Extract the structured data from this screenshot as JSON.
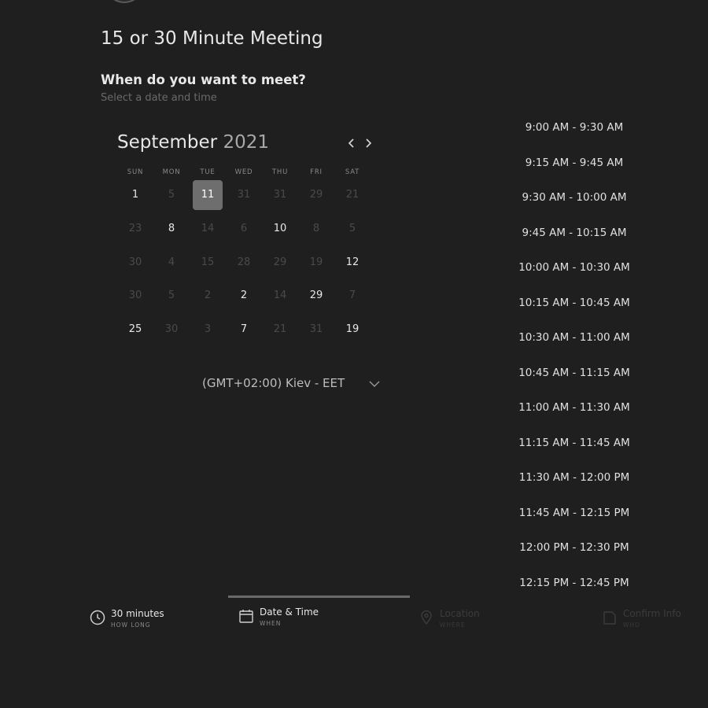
{
  "event": {
    "title": "15 or 30 Minute Meeting"
  },
  "prompt": {
    "question": "When do you want to meet?",
    "hint": "Select a date and time"
  },
  "calendar": {
    "month": "September",
    "year": "2021",
    "weekdays": [
      "SUN",
      "MON",
      "TUE",
      "WED",
      "THU",
      "FRI",
      "SAT"
    ],
    "weeks": [
      [
        "1",
        "5",
        "11",
        "31",
        "31",
        "29",
        "21"
      ],
      [
        "23",
        "8",
        "14",
        "6",
        "10",
        "8",
        "5"
      ],
      [
        "30",
        "4",
        "15",
        "28",
        "29",
        "19",
        "12"
      ],
      [
        "30",
        "5",
        "2",
        "2",
        "14",
        "29",
        "7"
      ],
      [
        "25",
        "30",
        "3",
        "7",
        "21",
        "31",
        "19"
      ]
    ],
    "available": [
      [
        true,
        false,
        true,
        false,
        false,
        false,
        false
      ],
      [
        false,
        true,
        false,
        false,
        true,
        false,
        false
      ],
      [
        false,
        false,
        false,
        false,
        false,
        false,
        true
      ],
      [
        false,
        false,
        false,
        true,
        false,
        true,
        false
      ],
      [
        true,
        false,
        false,
        true,
        false,
        false,
        true
      ]
    ],
    "selected": [
      0,
      2
    ]
  },
  "timezone": {
    "label": "(GMT+02:00) Kiev - EET"
  },
  "time_slots": [
    "9:00 AM - 9:30 AM",
    "9:15 AM - 9:45 AM",
    "9:30 AM - 10:00 AM",
    "9:45 AM - 10:15 AM",
    "10:00 AM - 10:30 AM",
    "10:15 AM - 10:45 AM",
    "10:30 AM - 11:00 AM",
    "10:45 AM - 11:15 AM",
    "11:00 AM - 11:30 AM",
    "11:15 AM - 11:45 AM",
    "11:30 AM - 12:00 PM",
    "11:45 AM - 12:15 PM",
    "12:00 PM - 12:30 PM",
    "12:15 PM - 12:45 PM"
  ],
  "steps": [
    {
      "label": "30 minutes",
      "sub": "HOW LONG",
      "icon": "clock-icon"
    },
    {
      "label": "Date & Time",
      "sub": "WHEN",
      "icon": "calendar-icon"
    },
    {
      "label": "Location",
      "sub": "WHERE",
      "icon": "location-pin-icon"
    },
    {
      "label": "Confirm Info",
      "sub": "WHO",
      "icon": "document-icon"
    }
  ],
  "colors": {
    "background": "#1f1f1f",
    "selected_day": "#6e6e6e",
    "active_step_bar": "#6a6a6a"
  }
}
